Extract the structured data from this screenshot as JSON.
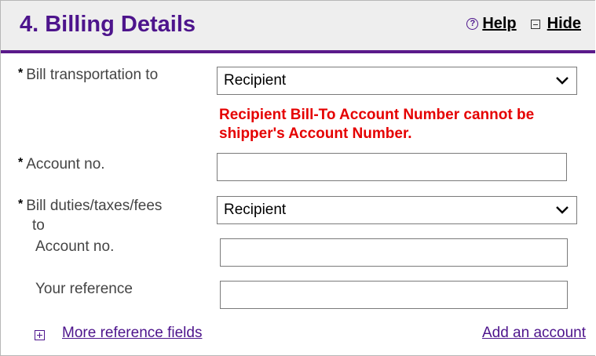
{
  "section": {
    "title": "4. Billing Details",
    "help_label": "Help",
    "hide_label": "Hide"
  },
  "fields": {
    "bill_transportation": {
      "label": "Bill transportation to",
      "value": "Recipient"
    },
    "error_message": "Recipient Bill-To Account Number cannot be shipper's Account Number.",
    "account_no_1": {
      "label": "Account no.",
      "value": ""
    },
    "bill_duties": {
      "label_line1": "Bill duties/taxes/fees",
      "label_line2": "to",
      "value": "Recipient"
    },
    "account_no_2": {
      "label": "Account no.",
      "value": ""
    },
    "your_reference": {
      "label": "Your reference",
      "value": ""
    }
  },
  "required_marker": "*",
  "footer": {
    "more_reference_fields": "More reference fields",
    "add_account": "Add an account"
  },
  "colors": {
    "brand_purple": "#4d148c",
    "error_red": "#e50000",
    "header_bg": "#eeeeee"
  }
}
